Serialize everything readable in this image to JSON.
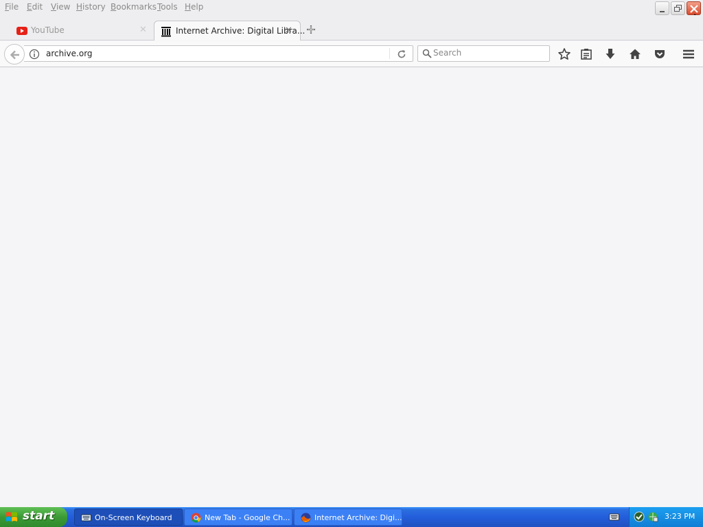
{
  "menubar": {
    "items": [
      "File",
      "Edit",
      "View",
      "History",
      "Bookmarks",
      "Tools",
      "Help"
    ]
  },
  "tabs": [
    {
      "label": "YouTube",
      "icon": "youtube-icon",
      "active": false
    },
    {
      "label": "Internet Archive: Digital Libra...",
      "icon": "internet-archive-icon",
      "active": true
    }
  ],
  "navbar": {
    "url": "archive.org",
    "search_placeholder": "Search"
  },
  "taskbar": {
    "start_label": "start",
    "tasks": [
      {
        "label": "On-Screen Keyboard",
        "icon": "keyboard-icon"
      },
      {
        "label": "New Tab - Google Ch...",
        "icon": "chrome-icon"
      },
      {
        "label": "Internet Archive: Digi...",
        "icon": "firefox-icon"
      }
    ],
    "clock": "3:23 PM"
  },
  "colors": {
    "taskbar_blue": "#245edb",
    "start_green": "#3c9a36",
    "close_red": "#d94a2c",
    "youtube_red": "#e62117"
  }
}
